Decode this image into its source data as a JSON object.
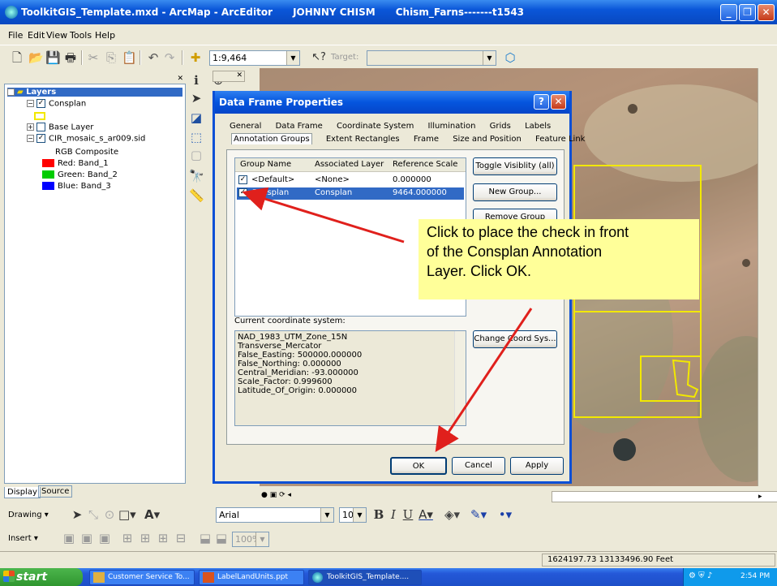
{
  "window": {
    "title": "ToolkitGIS_Template.mxd - ArcMap - ArcEditor      JOHNNY CHISM      Chism_Farns-------t1543"
  },
  "menu": [
    "File",
    "Edit",
    "View",
    "Tools",
    "Help"
  ],
  "toolbar": {
    "scale": "1:9,464",
    "target_label": "Target:"
  },
  "toc": {
    "root": "Layers",
    "layers": [
      {
        "label": "Consplan",
        "checked": true
      },
      {
        "label": "Base Layer",
        "checked": false
      },
      {
        "label": "CIR_mosaic_s_ar009.sid",
        "checked": true
      }
    ],
    "composite": "RGB Composite",
    "bands": [
      {
        "label": "Red:  Band_1",
        "color": "#ff0000"
      },
      {
        "label": "Green: Band_2",
        "color": "#00cc00"
      },
      {
        "label": "Blue:  Band_3",
        "color": "#0000ff"
      }
    ],
    "tabs": [
      "Display",
      "Source"
    ]
  },
  "dialog": {
    "title": "Data Frame Properties",
    "tabs_row1": [
      "General",
      "Data Frame",
      "Coordinate System",
      "Illumination",
      "Grids",
      "Labels"
    ],
    "tabs_row2": [
      "Annotation Groups",
      "Extent Rectangles",
      "Frame",
      "Size and Position",
      "Feature Link"
    ],
    "columns": [
      "Group Name",
      "Associated Layer",
      "Reference Scale"
    ],
    "rows": [
      {
        "name": "<Default>",
        "layer": "<None>",
        "scale": "0.000000",
        "selected": false
      },
      {
        "name": "Consplan",
        "layer": "Consplan",
        "scale": "9464.000000",
        "selected": true
      }
    ],
    "buttons": {
      "toggle": "Toggle Visiblity (all)",
      "new_group": "New Group...",
      "remove_group": "Remove Group",
      "change_coord": "Change Coord Sys...",
      "ok": "OK",
      "cancel": "Cancel",
      "apply": "Apply"
    },
    "coord_label": "Current coordinate system:",
    "coord_lines": [
      "NAD_1983_UTM_Zone_15N",
      "Transverse_Mercator",
      "False_Easting: 500000.000000",
      "False_Northing: 0.000000",
      "Central_Meridian: -93.000000",
      "Scale_Factor: 0.999600",
      "Latitude_Of_Origin: 0.000000"
    ]
  },
  "callout": {
    "lines": [
      "Click to place the check in front",
      "of the Consplan Annotation",
      "Layer. Click OK."
    ]
  },
  "drawing": {
    "drawing_label": "Drawing",
    "insert_label": "Insert",
    "font": "Arial",
    "font_size": "10",
    "zoom": "100%"
  },
  "status": {
    "coords": "1624197.73  13133496.90 Feet"
  },
  "taskbar": {
    "start": "start",
    "tasks": [
      "Customer Service To...",
      "LabelLandUnits.ppt",
      "ToolkitGIS_Template...."
    ],
    "clock": "2:54 PM"
  },
  "colors": {
    "titlebar": "#0a56d8",
    "callout": "#ffff99",
    "arrow": "#e0201c",
    "parcel": "#f2e800"
  }
}
